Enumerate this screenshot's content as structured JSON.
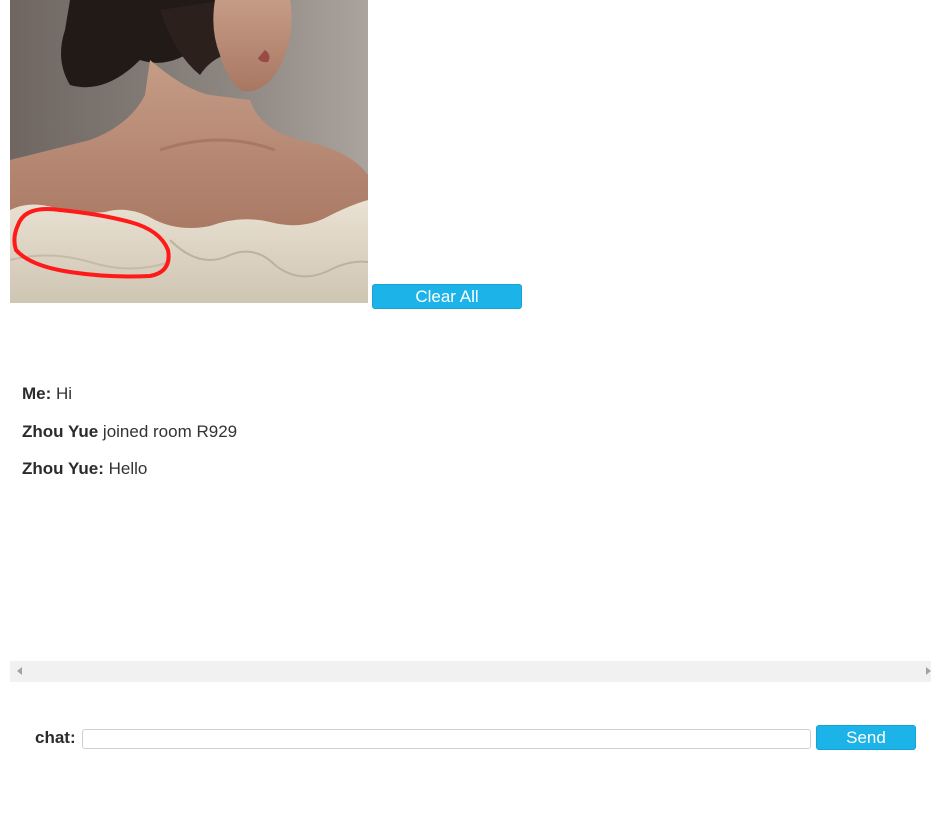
{
  "photo": {
    "description_icon": "portrait-photo",
    "annotation_color": "#ff1a1a"
  },
  "toolbar": {
    "clear_label": "Clear All"
  },
  "messages": [
    {
      "sender": "Me:",
      "text": " Hi"
    },
    {
      "sender": "Zhou Yue",
      "text": " joined room R929"
    },
    {
      "sender": "Zhou Yue:",
      "text": " Hello"
    }
  ],
  "chat": {
    "label": "chat:",
    "input_value": "",
    "send_label": "Send"
  },
  "colors": {
    "button_bg": "#1cb3e8",
    "button_text": "#ffffff",
    "scrollbar_bg": "#f1f1f1"
  }
}
